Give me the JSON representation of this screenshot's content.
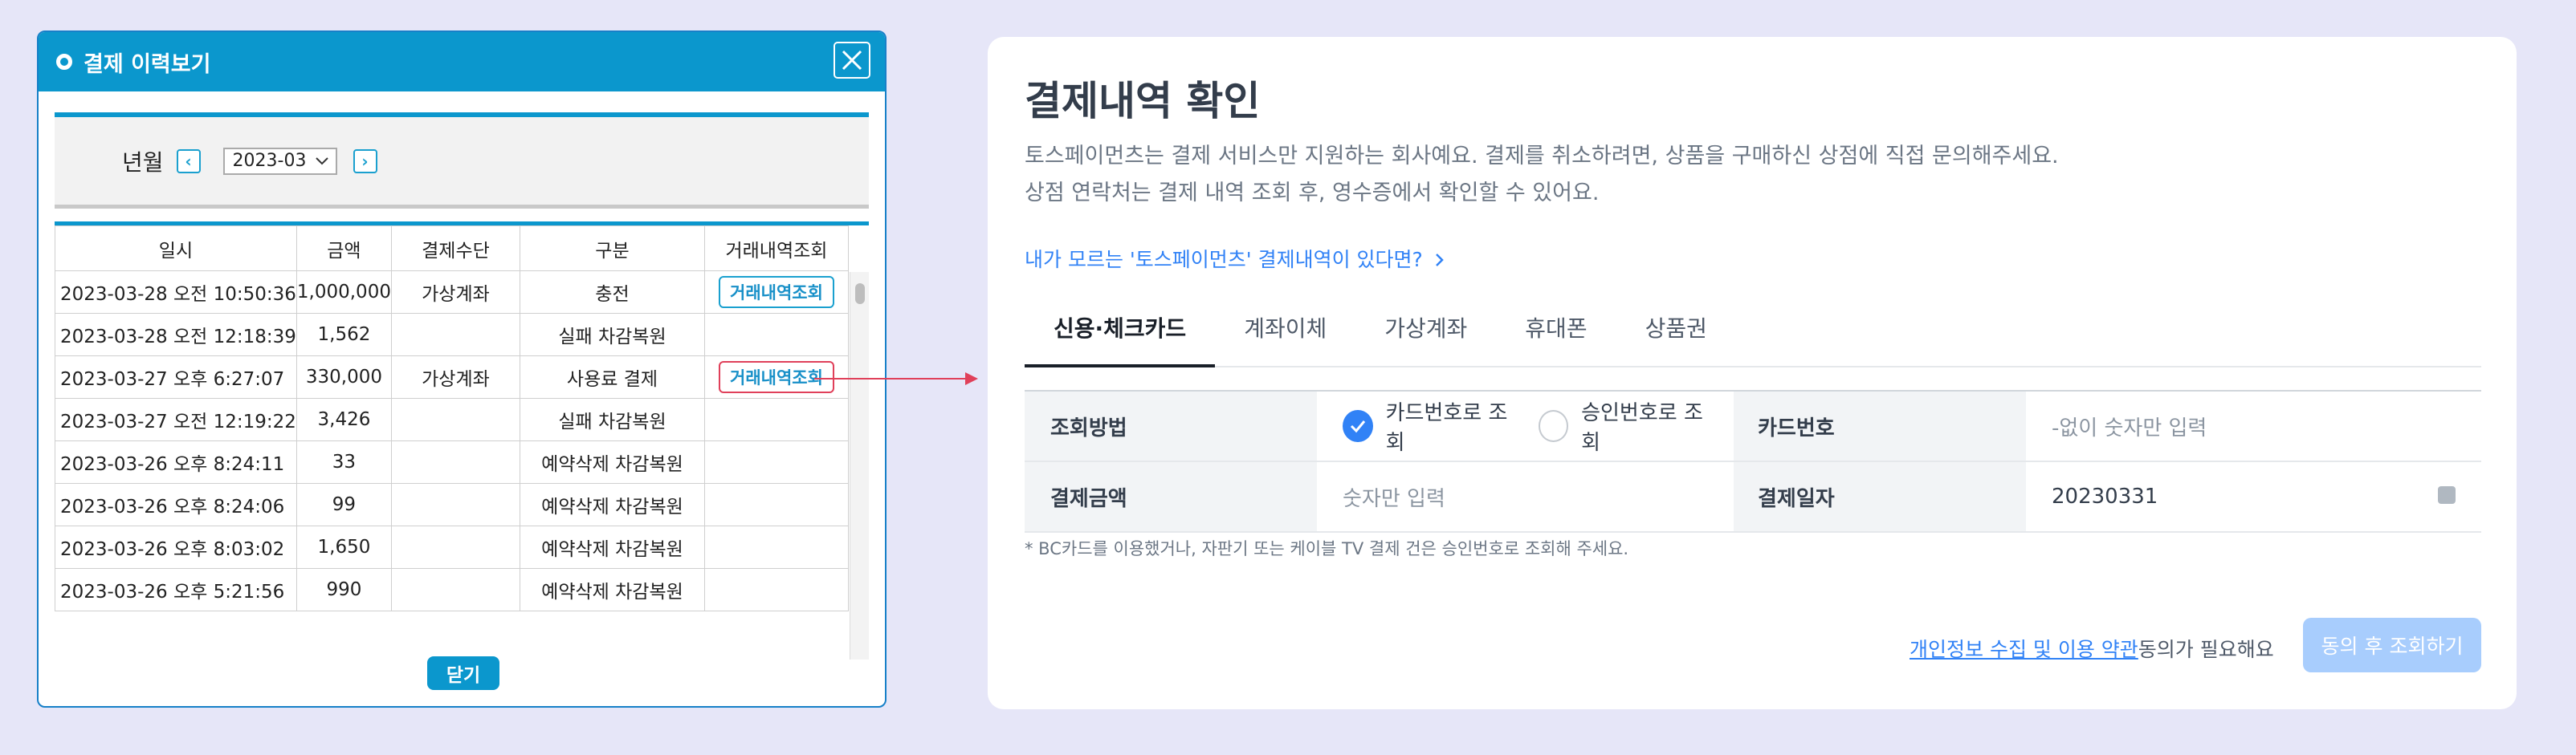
{
  "popup": {
    "title": "결제 이력보기",
    "filter_label": "년월",
    "selected_month": "2023-03",
    "prev_symbol": "‹",
    "next_symbol": "›",
    "columns": [
      "일시",
      "금액",
      "결제수단",
      "구분",
      "거래내역조회"
    ],
    "rows": [
      {
        "date": "2023-03-28 오전 10:50:36",
        "amount": "1,000,000",
        "method": "가상계좌",
        "type": "충전",
        "lookup": "거래내역조회"
      },
      {
        "date": "2023-03-28 오전 12:18:39",
        "amount": "1,562",
        "method": "",
        "type": "실패 차감복원",
        "lookup": ""
      },
      {
        "date": "2023-03-27 오후 6:27:07",
        "amount": "330,000",
        "method": "가상계좌",
        "type": "사용료 결제",
        "lookup": "거래내역조회"
      },
      {
        "date": "2023-03-27 오전 12:19:22",
        "amount": "3,426",
        "method": "",
        "type": "실패 차감복원",
        "lookup": ""
      },
      {
        "date": "2023-03-26 오후 8:24:11",
        "amount": "33",
        "method": "",
        "type": "예약삭제 차감복원",
        "lookup": ""
      },
      {
        "date": "2023-03-26 오후 8:24:06",
        "amount": "99",
        "method": "",
        "type": "예약삭제 차감복원",
        "lookup": ""
      },
      {
        "date": "2023-03-26 오후 8:03:02",
        "amount": "1,650",
        "method": "",
        "type": "예약삭제 차감복원",
        "lookup": ""
      },
      {
        "date": "2023-03-26 오후 5:21:56",
        "amount": "990",
        "method": "",
        "type": "예약삭제 차감복원",
        "lookup": ""
      }
    ],
    "close_label": "닫기"
  },
  "panel": {
    "title": "결제내역 확인",
    "desc_line1": "토스페이먼츠는 결제 서비스만 지원하는 회사예요. 결제를 취소하려면, 상품을 구매하신 상점에 직접 문의해주세요.",
    "desc_line2": "상점 연락처는 결제 내역 조회 후, 영수증에서 확인할 수 있어요.",
    "help_link": "내가 모르는 '토스페이먼츠' 결제내역이 있다면?",
    "tabs": [
      "신용·체크카드",
      "계좌이체",
      "가상계좌",
      "휴대폰",
      "상품권"
    ],
    "form": {
      "method_label": "조회방법",
      "radio_card": "카드번호로 조회",
      "radio_approval": "승인번호로 조회",
      "card_label": "카드번호",
      "card_placeholder": "-없이 숫자만 입력",
      "amount_label": "결제금액",
      "amount_placeholder": "숫자만 입력",
      "date_label": "결제일자",
      "date_value": "20230331"
    },
    "notice": "* BC카드를 이용했거나, 자판기 또는 케이블 TV 결제 건은 승인번호로 조회해 주세요.",
    "agree_link": "개인정보 수집 및 이용 약관",
    "agree_suffix": "동의가 필요해요",
    "submit_label": "동의 후 조회하기"
  },
  "colors": {
    "popup_header": "#0b97cd",
    "highlight": "#e0405a",
    "toss_blue": "#3182f6",
    "background": "#e6e6f8"
  }
}
